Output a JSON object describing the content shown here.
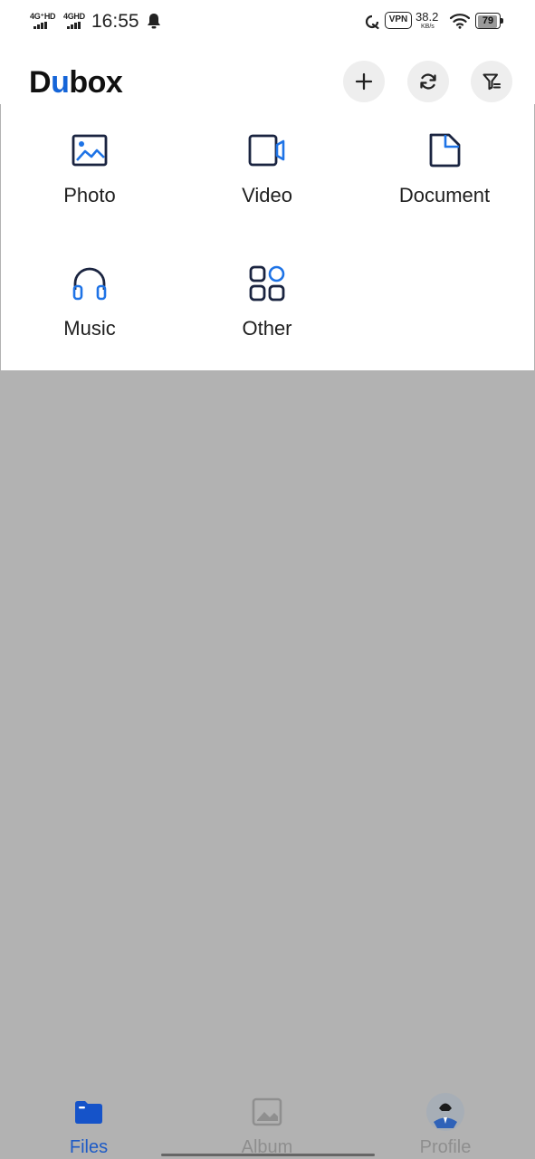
{
  "status_bar": {
    "network_1": "4G⁺HD",
    "network_2": "4GHD",
    "time": "16:55",
    "vpn": "VPN",
    "speed_value": "38.2",
    "speed_unit": "KB/s",
    "battery_level": "79"
  },
  "header": {
    "logo_prefix": "D",
    "logo_accent": "u",
    "logo_suffix": "box",
    "accent_color": "#1565d8",
    "actions": [
      "plus-icon",
      "sync-icon",
      "filter-icon"
    ]
  },
  "categories": [
    {
      "label": "Photo",
      "icon": "photo-icon"
    },
    {
      "label": "Video",
      "icon": "video-icon"
    },
    {
      "label": "Document",
      "icon": "document-icon"
    },
    {
      "label": "Music",
      "icon": "headphones-icon"
    },
    {
      "label": "Other",
      "icon": "grid-icon"
    }
  ],
  "overlay_color": "#b2b2b2",
  "bottom_nav": {
    "tabs": [
      {
        "label": "Files",
        "icon": "folder-icon",
        "active": true
      },
      {
        "label": "Album",
        "icon": "image-icon",
        "active": false
      },
      {
        "label": "Profile",
        "icon": "avatar",
        "active": false
      }
    ],
    "active_color": "#1e5bc6"
  }
}
